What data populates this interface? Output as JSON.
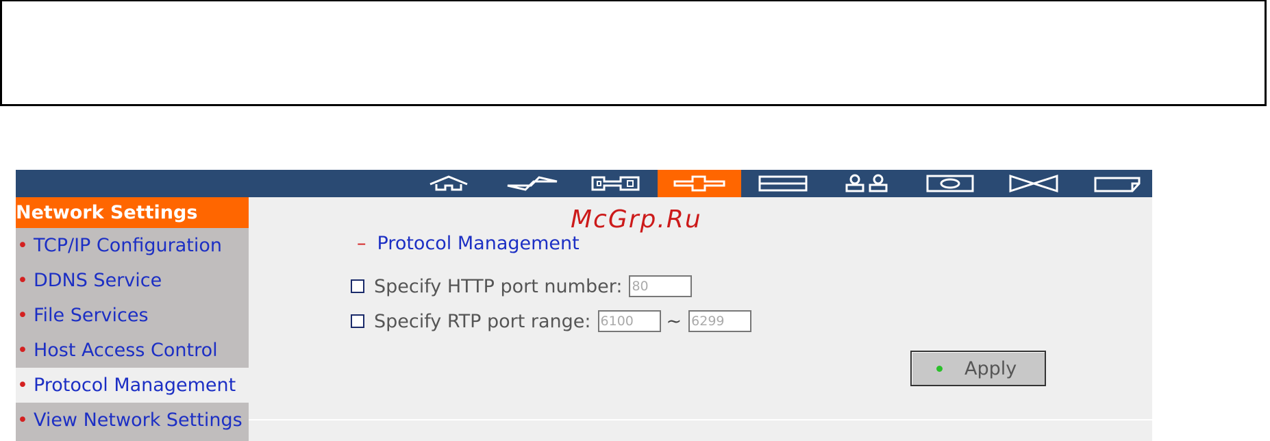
{
  "watermark": "McGrp.Ru",
  "colors": {
    "navbar": "#2a4a73",
    "accent": "#ff6600",
    "link": "#1c2fc4",
    "bullet": "#d42020",
    "apply_dot": "#2bc02b"
  },
  "nav_tabs": [
    {
      "icon": "home-icon",
      "active": false
    },
    {
      "icon": "lightning-icon",
      "active": false
    },
    {
      "icon": "key-icon",
      "active": false
    },
    {
      "icon": "network-icon",
      "active": true
    },
    {
      "icon": "disk-icon",
      "active": false
    },
    {
      "icon": "users-icon",
      "active": false
    },
    {
      "icon": "device-icon",
      "active": false
    },
    {
      "icon": "hourglass-icon",
      "active": false
    },
    {
      "icon": "note-icon",
      "active": false
    }
  ],
  "sidebar": {
    "title": "Network Settings",
    "bullet": "•",
    "items": [
      {
        "label": "TCP/IP Configuration",
        "active": false
      },
      {
        "label": "DDNS Service",
        "active": false
      },
      {
        "label": "File Services",
        "active": false
      },
      {
        "label": "Host Access Control",
        "active": false
      },
      {
        "label": "Protocol Management",
        "active": true
      },
      {
        "label": "View Network Settings",
        "active": false
      }
    ]
  },
  "main": {
    "section_dash": "–",
    "section_title": "Protocol Management",
    "http": {
      "label": "Specify HTTP port number:",
      "value": "80"
    },
    "rtp": {
      "label": "Specify RTP port range:",
      "from": "6100",
      "separator": "~",
      "to": "6299"
    },
    "apply_label": "Apply"
  }
}
